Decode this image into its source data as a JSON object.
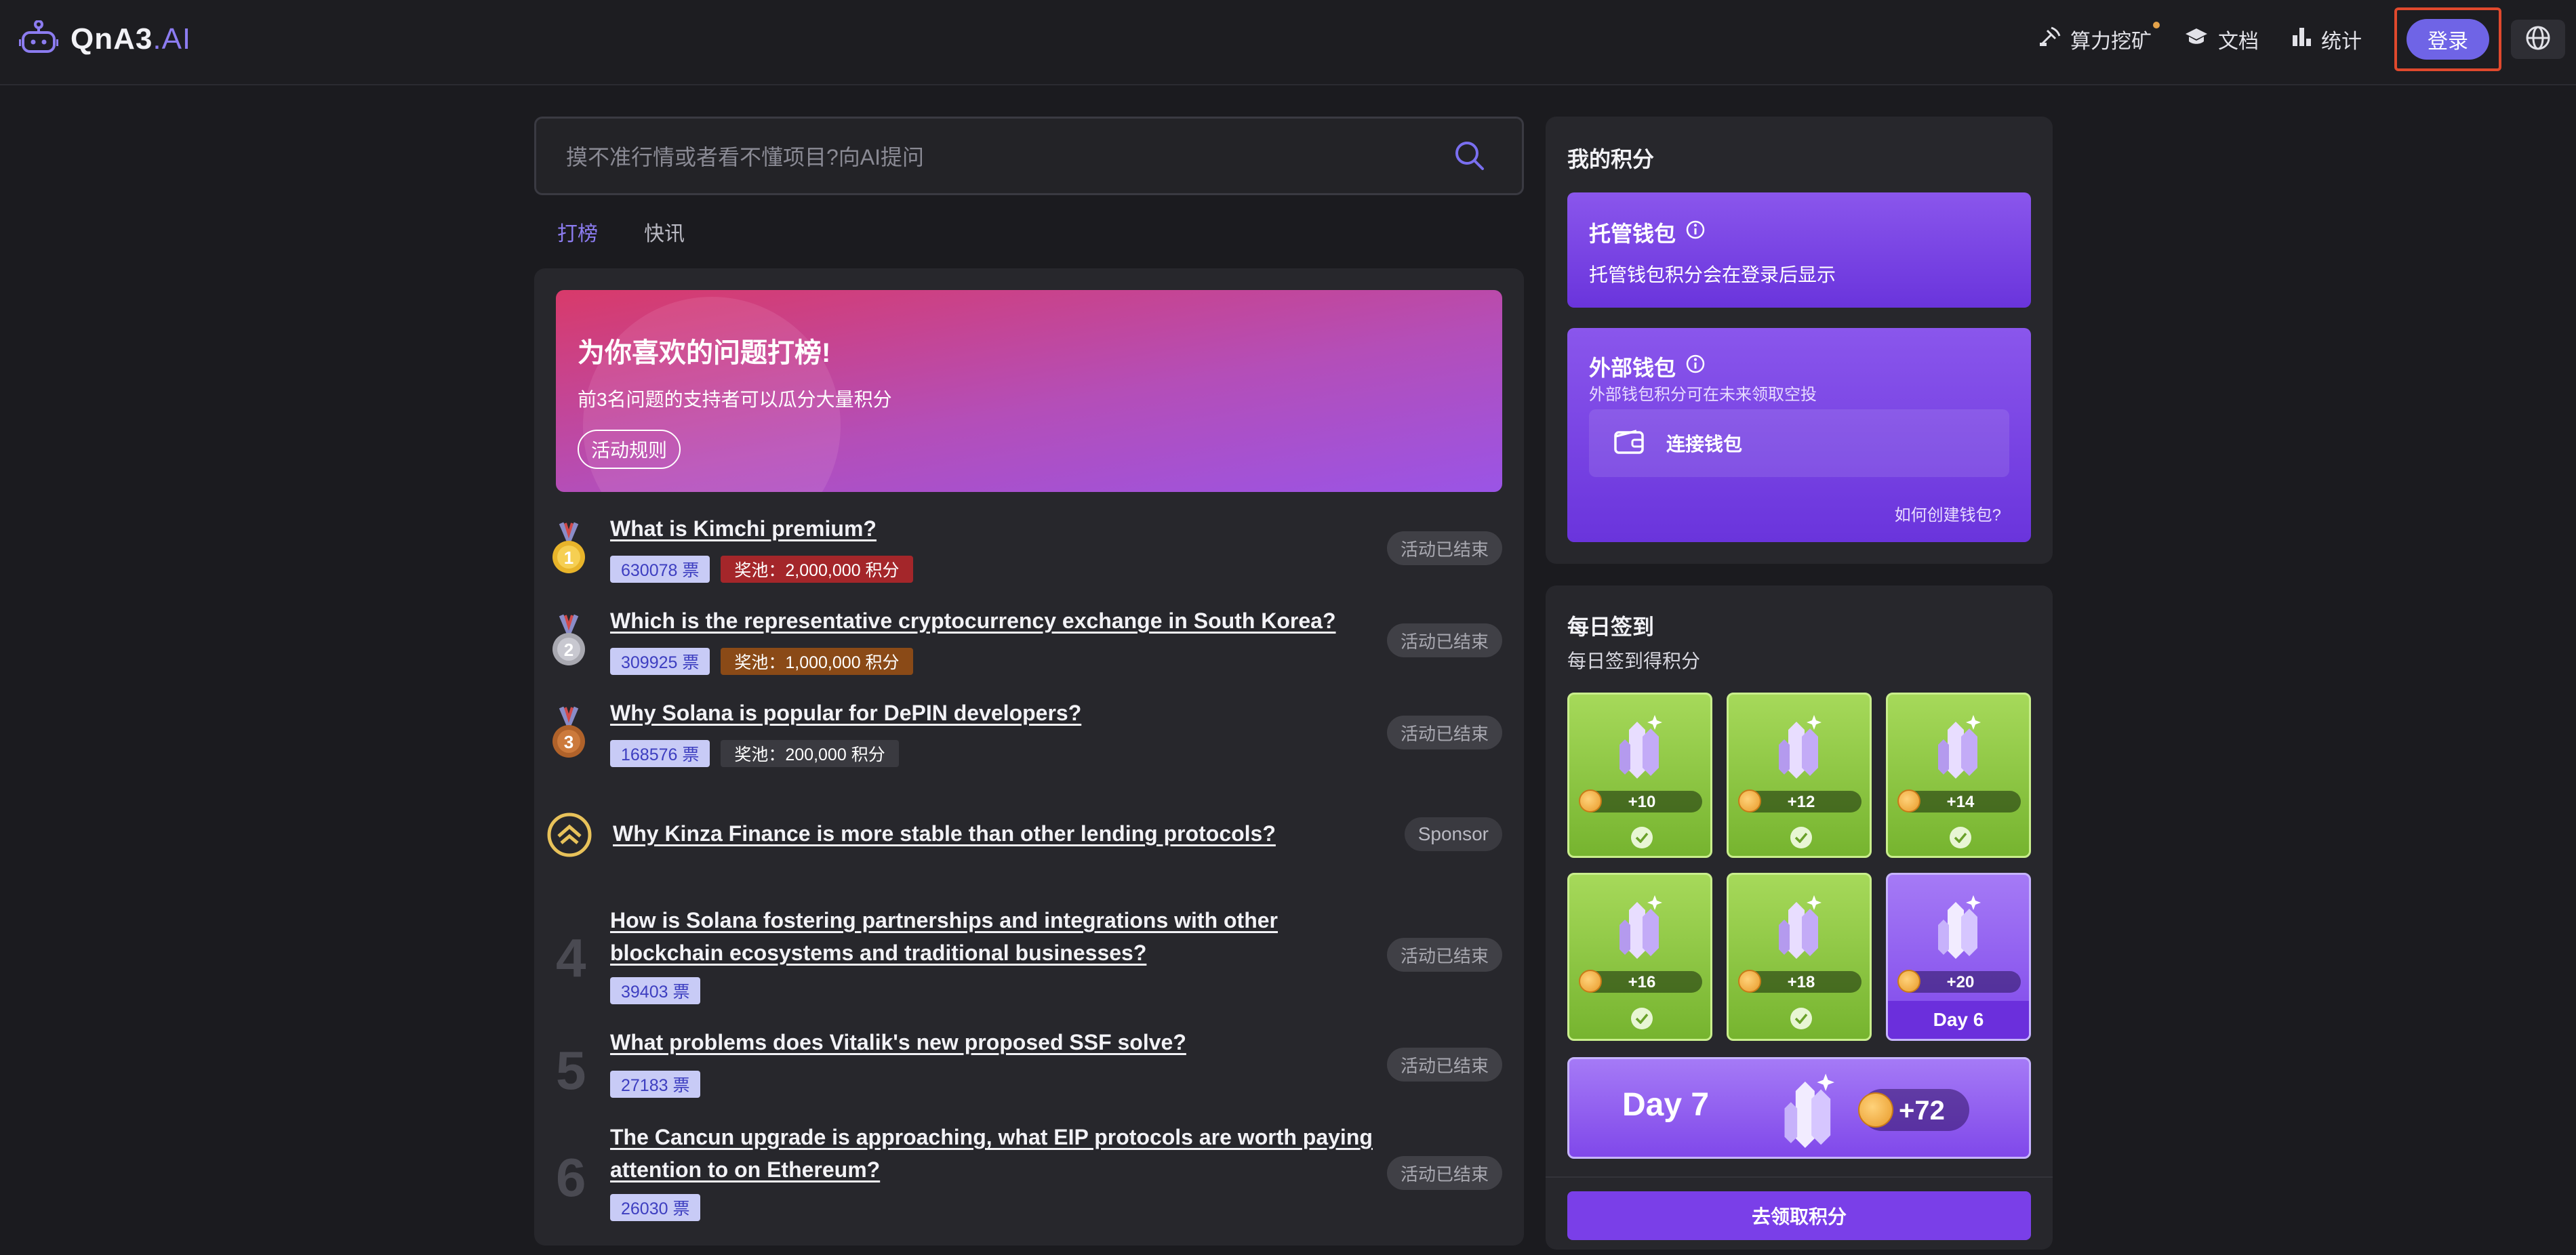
{
  "header": {
    "logo_text": "QnA3",
    "logo_suffix": ".AI",
    "nav": {
      "mining": "算力挖矿",
      "docs": "文档",
      "stats": "统计"
    },
    "login": "登录"
  },
  "search": {
    "placeholder": "摸不准行情或者看不懂项目?向AI提问"
  },
  "tabs": [
    "打榜",
    "快讯"
  ],
  "banner": {
    "title": "为你喜欢的问题打榜!",
    "subtitle": "前3名问题的支持者可以瓜分大量积分",
    "rules_button": "活动规则"
  },
  "ranking": [
    {
      "title": "What is Kimchi premium?",
      "votes": "630078 票",
      "pool": "奖池：2,000,000 积分",
      "status": "活动已结束"
    },
    {
      "title": "Which is the representative cryptocurrency exchange in South Korea?",
      "votes": "309925 票",
      "pool": "奖池：1,000,000 积分",
      "status": "活动已结束"
    },
    {
      "title": "Why Solana is popular for DePIN developers?",
      "votes": "168576 票",
      "pool": "奖池：200,000 积分",
      "status": "活动已结束"
    }
  ],
  "sponsor": {
    "title": "Why Kinza Finance is more stable than other lending protocols?",
    "badge": "Sponsor"
  },
  "more": [
    {
      "rank": "4",
      "title": "How is Solana fostering partnerships and integrations with other blockchain ecosystems and traditional businesses?",
      "votes": "39403 票",
      "status": "活动已结束"
    },
    {
      "rank": "5",
      "title": "What problems does Vitalik's new proposed SSF solve?",
      "votes": "27183 票",
      "status": "活动已结束"
    },
    {
      "rank": "6",
      "title": "The Cancun upgrade is approaching, what EIP protocols are worth paying attention to on Ethereum?",
      "votes": "26030 票",
      "status": "活动已结束"
    }
  ],
  "points": {
    "title": "我的积分",
    "custodial": {
      "title": "托管钱包",
      "text": "托管钱包积分会在登录后显示"
    },
    "external": {
      "title": "外部钱包",
      "text": "外部钱包积分可在未来领取空投",
      "connect": "连接钱包",
      "howto": "如何创建钱包?"
    }
  },
  "checkin": {
    "title": "每日签到",
    "subtitle": "每日签到得积分",
    "days": [
      "+10",
      "+12",
      "+14",
      "+16",
      "+18",
      "+20"
    ],
    "today_label": "Day 6",
    "day7_label": "Day 7",
    "day7_reward": "+72",
    "claim": "去领取积分"
  },
  "colors": {
    "accent": "#8c7cf0",
    "login": "#6f64e6",
    "highlight_box": "#e0492d"
  }
}
